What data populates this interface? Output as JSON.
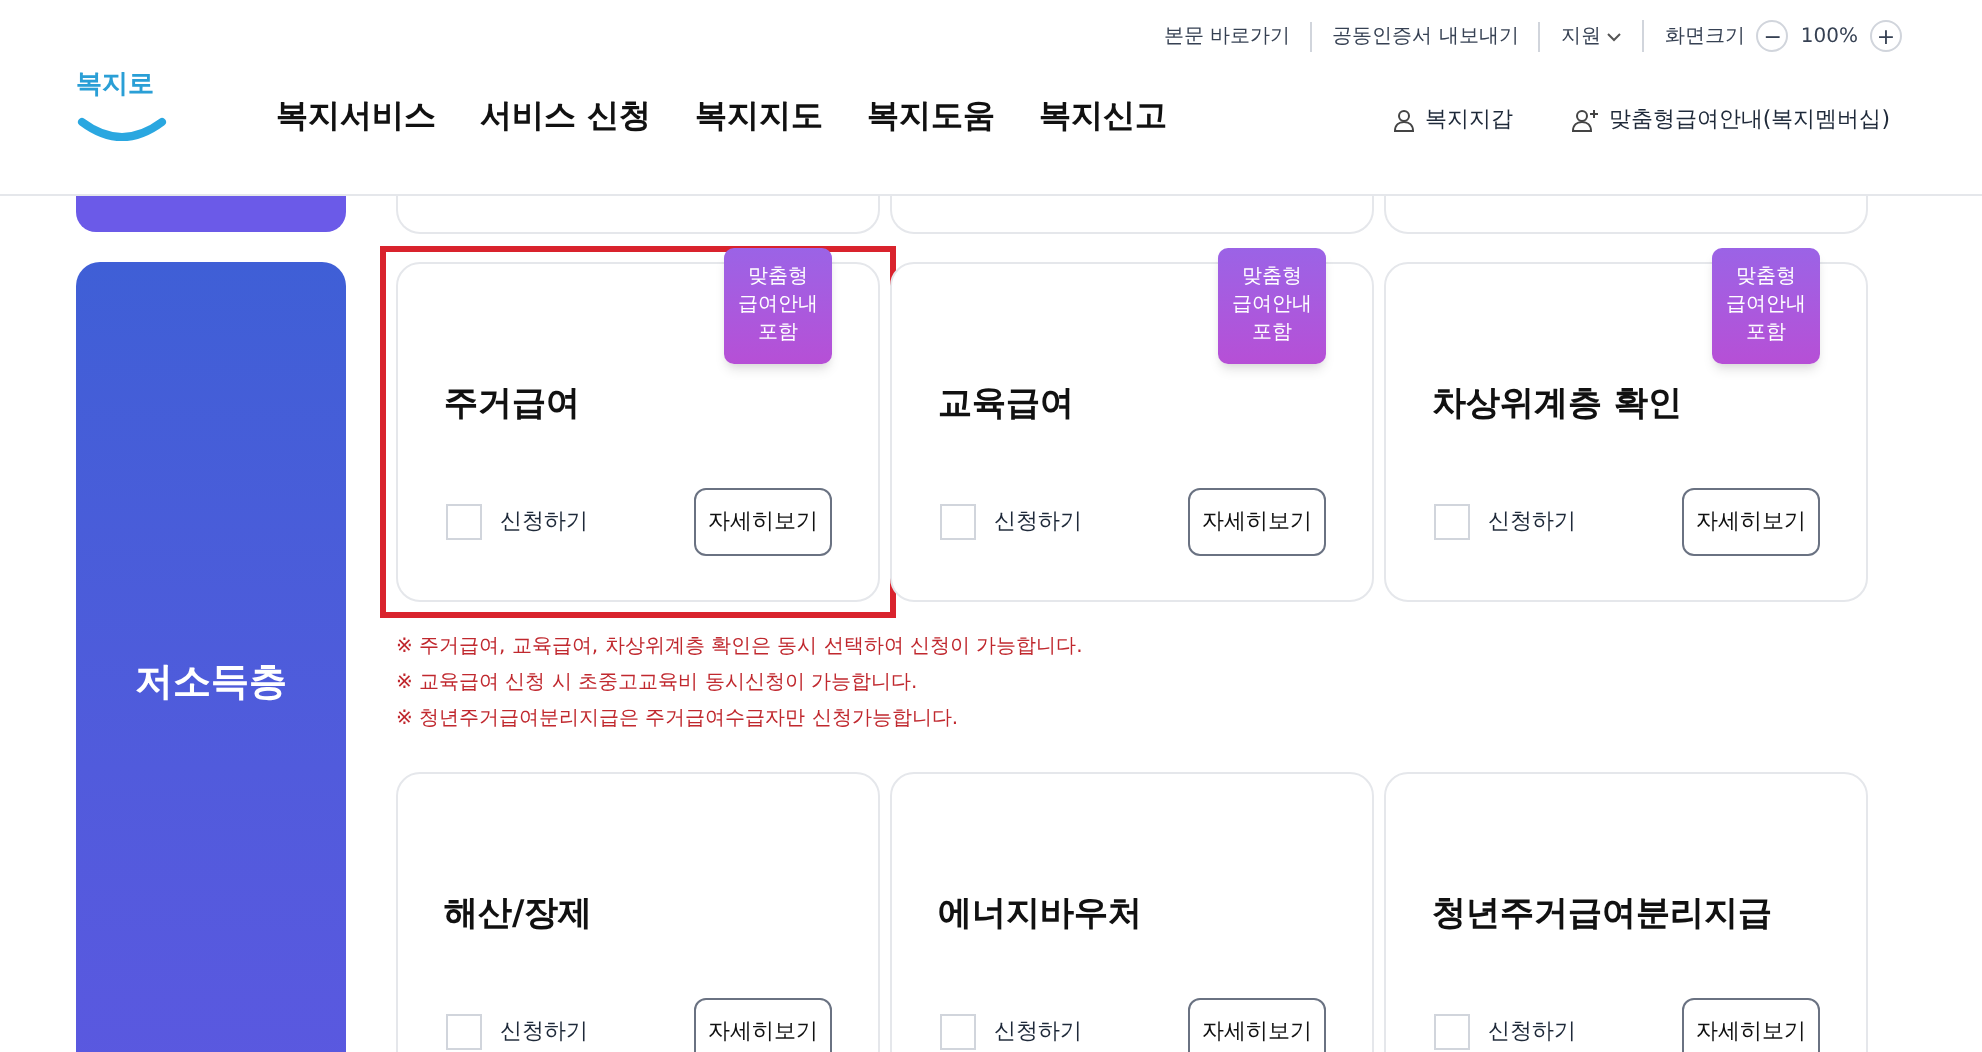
{
  "utility_links": [
    {
      "label": "본문 바로가기",
      "kind": "link"
    },
    {
      "label": "공동인증서 내보내기",
      "kind": "link"
    },
    {
      "label": "지원",
      "kind": "dropdown"
    }
  ],
  "zoom": {
    "label": "화면크기",
    "minus": "−",
    "value": "100%",
    "plus": "+"
  },
  "logo": "복지로",
  "nav": [
    "복지서비스",
    "서비스 신청",
    "복지지도",
    "복지도움",
    "복지신고"
  ],
  "user_links": [
    {
      "label": "복지지갑",
      "kind": "person"
    },
    {
      "label": "맞춤형급여안내(복지멤버십)",
      "kind": "person-add"
    }
  ],
  "category": {
    "label": "저소득층"
  },
  "cards_row_1": [
    {
      "title": "주거급여",
      "badge": "맞춤형\n급여안내\n포함",
      "checkbox_label": "신청하기",
      "checked": false,
      "button": "자세히보기",
      "highlighted": true
    },
    {
      "title": "교육급여",
      "badge": "맞춤형\n급여안내\n포함",
      "checkbox_label": "신청하기",
      "checked": false,
      "button": "자세히보기",
      "highlighted": false
    },
    {
      "title": "차상위계층 확인",
      "badge": "맞춤형\n급여안내\n포함",
      "checkbox_label": "신청하기",
      "checked": false,
      "button": "자세히보기",
      "highlighted": false
    }
  ],
  "notes": [
    "※ 주거급여, 교육급여, 차상위계층 확인은 동시 선택하여 신청이 가능합니다.",
    "※ 교육급여 신청 시 초중고교육비 동시신청이 가능합니다.",
    "※ 청년주거급여분리지급은 주거급여수급자만 신청가능합니다."
  ],
  "cards_row_2": [
    {
      "title": "해산/장제",
      "checkbox_label": "신청하기",
      "checked": false,
      "button": "자세히보기",
      "highlighted": false
    },
    {
      "title": "에너지바우처",
      "checkbox_label": "신청하기",
      "checked": false,
      "button": "자세히보기",
      "highlighted": false
    },
    {
      "title": "청년주거급여분리지급",
      "checkbox_label": "신청하기",
      "checked": false,
      "button": "자세히보기",
      "highlighted": false
    }
  ]
}
